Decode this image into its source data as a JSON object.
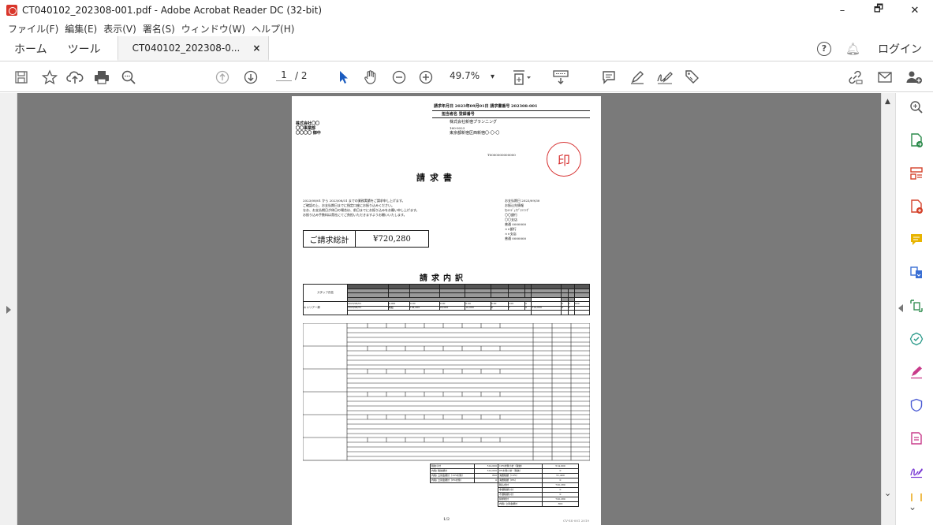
{
  "window": {
    "title": "CT040102_202308-001.pdf - Adobe Acrobat Reader DC (32-bit)",
    "minimize": "–",
    "restore": "🗗",
    "close": "✕"
  },
  "menu": [
    "ファイル(F)",
    "編集(E)",
    "表示(V)",
    "署名(S)",
    "ウィンドウ(W)",
    "ヘルプ(H)"
  ],
  "tabs": {
    "home": "ホーム",
    "tools": "ツール",
    "document": "CT040102_202308-0...",
    "close": "×",
    "help": "?",
    "login": "ログイン"
  },
  "toolbar": {
    "current_page": "1",
    "page_total": "/ 2",
    "zoom": "49.7%",
    "zoom_caret": "▾"
  },
  "document": {
    "header_line1": "請求年月日 2023年09月01日 請求書番号 202308-001",
    "header_line2": "担当者名 登録番号",
    "recipient_lines": [
      "株式会社〇〇",
      "〇〇事業部",
      "〇〇〇〇 御中"
    ],
    "issuer_lines": [
      "株式会社新宿プランニング",
      "160-0023",
      "東京都新宿区西新宿〇-〇-〇"
    ],
    "reg_no": "T0000000000000",
    "title": "請求書",
    "seal": "印",
    "period_text": "2023/08/01 から 2023/08/31 までの業務実績をご請求申し上げます。",
    "note_lines": [
      "ご確認の上、お支払期日までに指定口座にお振り込みください。",
      "なお、お支払期日が休日の場合は、前日までにお振り込みをお願い申し上げます。",
      "お振り込み手数料は貴社にてご負担いただきますようお願いいたします。"
    ],
    "payment_lines": [
      "お支払期日 2023/09/30",
      "お振込先情報",
      "ｶ)ｼﾝｼﾞｭｸﾌﾟﾗﾝﾆﾝｸﾞ",
      "〇〇銀行",
      "〇〇支店",
      "普通 0000000",
      "××銀行",
      "××支店",
      "普通 0000000"
    ],
    "total_label": "ご請求総計",
    "total_value": "¥720,280",
    "detail_title": "請求内訳",
    "staff_label": "スタッフ氏名",
    "staff_name": "キャリア一郎",
    "row1": [
      "2023/08/01",
      "4,000",
      "0.00",
      "0.00",
      "0.00",
      "0.00",
      "0.00",
      "0",
      "0",
      "0",
      "800"
    ],
    "row2": [
      "2023/08/31",
      "時給",
      "164,000",
      "20,000",
      "10,000",
      "0",
      "0",
      "0",
      "514,000",
      "0",
      "0"
    ],
    "sum_rows": [
      [
        "税抜小計",
        "514,000",
        "10%対象小計（税抜）",
        "514,000"
      ],
      [
        "内税) 税抜額計",
        "514,000",
        "8%対象小計（税抜）",
        "0"
      ],
      [
        "内税) 立替金額計（10%対象）",
        "800",
        "消費税額（10%）",
        "51,400"
      ],
      [
        "内税) 立替金額計（8%対象）",
        "0",
        "消費税額（8%）",
        "0"
      ],
      [
        "",
        "",
        "税込合計",
        "720,280"
      ],
      [
        "",
        "",
        "非課税額小計",
        "0"
      ],
      [
        "",
        "",
        "不課税額小計",
        "0"
      ],
      [
        "",
        "",
        "請求総計",
        "720,280"
      ],
      [
        "",
        "",
        "内税) 立替金額計",
        "800"
      ]
    ],
    "page_label": "1/2",
    "footer_code": "CV-SS-001 2019"
  }
}
